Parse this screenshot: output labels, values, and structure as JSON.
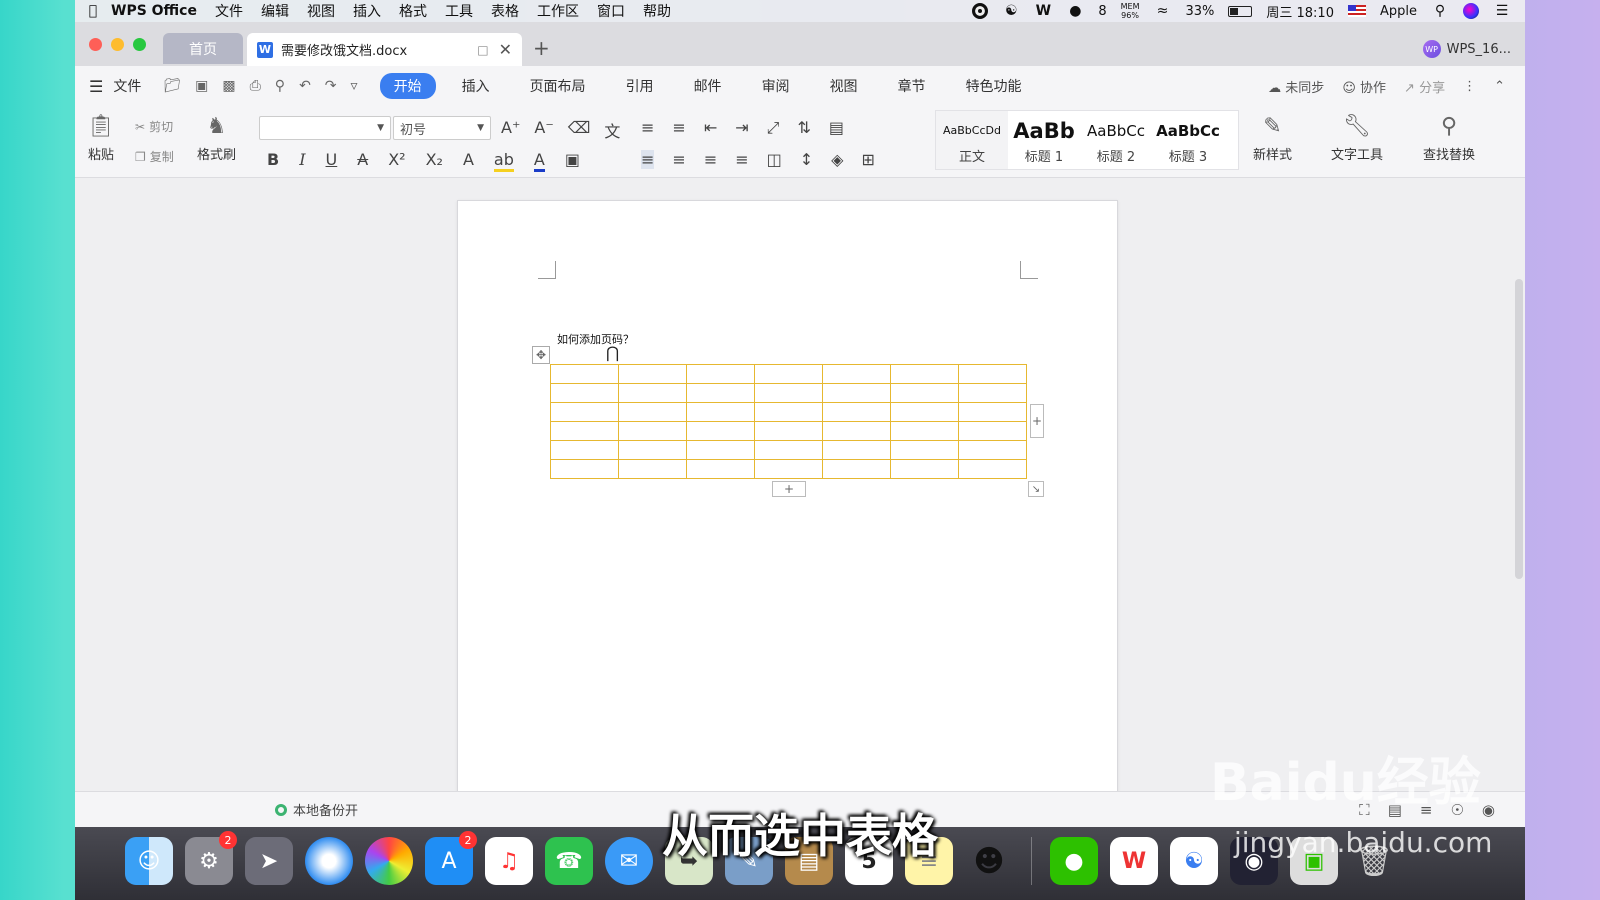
{
  "menubar": {
    "app_name": "WPS Office",
    "items": [
      "文件",
      "编辑",
      "视图",
      "插入",
      "格式",
      "工具",
      "表格",
      "工作区",
      "窗口",
      "帮助"
    ],
    "wechat_count": "8",
    "mem_label": "MEM",
    "mem_value": "96%",
    "battery": "33%",
    "clock": "周三 18:10",
    "user": "Apple"
  },
  "tabs": {
    "home": "首页",
    "doc_title": "需要修改饿文档.docx",
    "account": "WPS_16..."
  },
  "menu": {
    "file": "文件",
    "ribbon_tabs": [
      "开始",
      "插入",
      "页面布局",
      "引用",
      "邮件",
      "审阅",
      "视图",
      "章节",
      "特色功能"
    ],
    "sync": "未同步",
    "collab": "协作",
    "share": "分享"
  },
  "toolbar": {
    "paste": "粘贴",
    "cut": "剪切",
    "copy": "复制",
    "format_painter": "格式刷",
    "font_size": "初号",
    "styles": [
      {
        "sample": "AaBbCcDd",
        "name": "正文"
      },
      {
        "sample": "AaBb",
        "name": "标题 1"
      },
      {
        "sample": "AaBbCc",
        "name": "标题 2"
      },
      {
        "sample": "AaBbCc",
        "name": "标题 3"
      }
    ],
    "new_style": "新样式",
    "text_tools": "文字工具",
    "find_replace": "查找替换"
  },
  "document": {
    "text": "如何添加页码？",
    "table": {
      "rows": 6,
      "cols": 7
    }
  },
  "status": {
    "backup": "本地备份开"
  },
  "dock": {
    "settings_badge": "2",
    "appstore_badge": "2",
    "calendar_day": "5"
  },
  "subtitle": "从而选中表格",
  "watermark": {
    "logo": "Baidu经验",
    "url": "jingyan.baidu.com"
  },
  "colors": {
    "accent": "#3a7ef0",
    "table_lines": "#e6b830"
  }
}
